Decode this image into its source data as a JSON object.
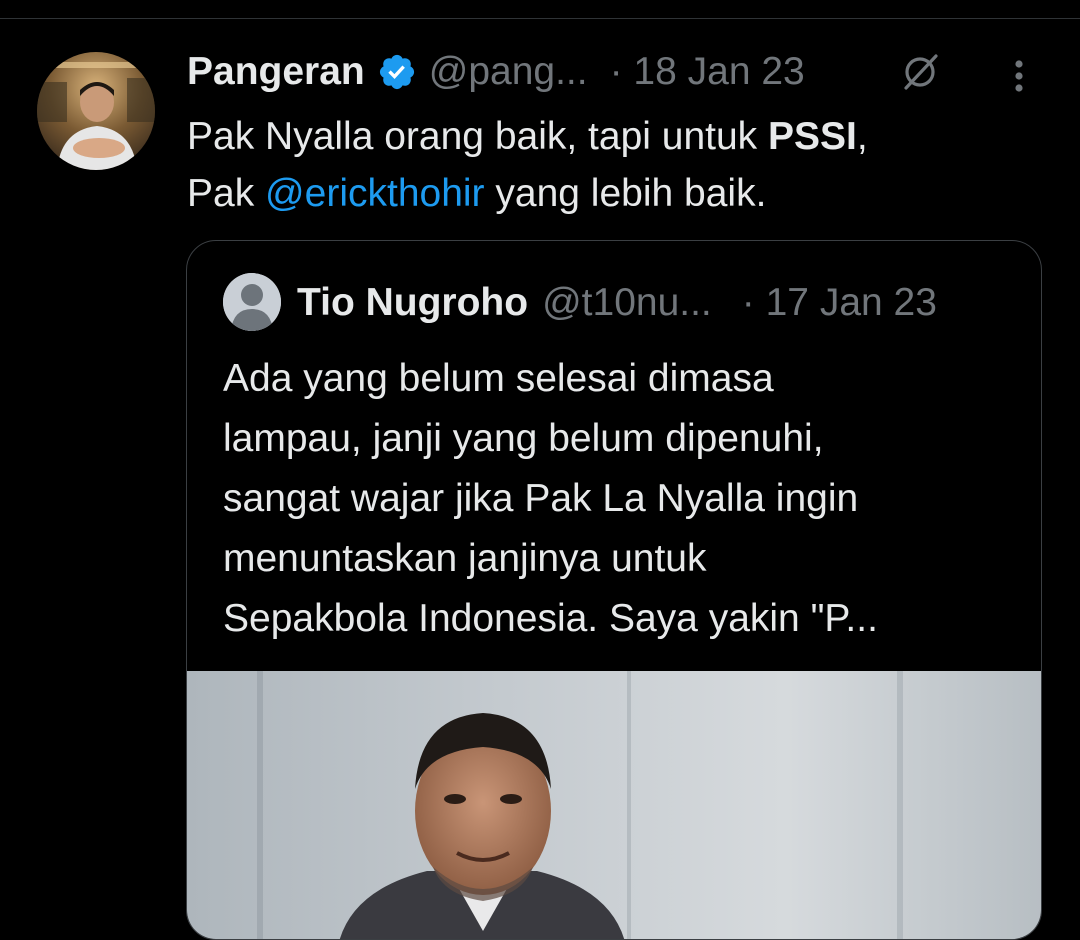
{
  "tweet": {
    "display_name": "Pangeran",
    "handle": "@pang...",
    "date": "· 18 Jan 23",
    "text": {
      "part1": "Pak Nyalla orang baik, tapi untuk ",
      "bold": "PSSI",
      "part2": ",",
      "part3": "Pak ",
      "mention": "@erickthohir",
      "part4": " yang lebih baik."
    },
    "icons": {
      "verified": "verified-badge-icon",
      "edit": "edit-history-icon",
      "more": "more-options-icon"
    }
  },
  "quote": {
    "display_name": "Tio Nugroho",
    "handle": "@t10nu...",
    "date": "· 17 Jan 23",
    "lines": [
      "Ada yang belum selesai dimasa",
      "lampau, janji yang belum dipenuhi,",
      "sangat wajar jika Pak La Nyalla ingin",
      "menuntaskan janjinya untuk",
      "Sepakbola Indonesia. Saya yakin \"P..."
    ]
  },
  "colors": {
    "background": "#000000",
    "text": "#e7e9ea",
    "muted": "#71767b",
    "link": "#1d9bf0",
    "border": "#2f3336",
    "verified": "#1d9bf0"
  }
}
